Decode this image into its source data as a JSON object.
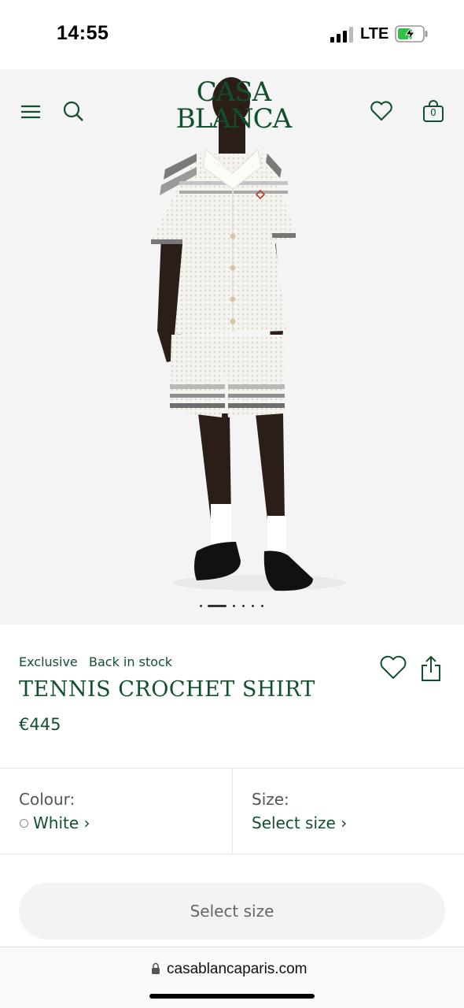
{
  "status_bar": {
    "time": "14:55",
    "network": "LTE",
    "icons": [
      "signal-bars-icon",
      "battery-charging-icon"
    ],
    "battery_color": "#30c048"
  },
  "header": {
    "logo_line1": "CASA",
    "logo_line2": "BLANCA",
    "cart_count": "0",
    "icons": [
      "menu-icon",
      "search-icon",
      "heart-icon",
      "bag-icon"
    ]
  },
  "gallery": {
    "image": "model-wearing-tennis-crochet-shirt-and-shorts",
    "active_slide": 1,
    "slide_count": 6
  },
  "product": {
    "badge_exclusive": "Exclusive",
    "badge_stock": "Back in stock",
    "name": "TENNIS CROCHET SHIRT",
    "price": "€445",
    "icons": [
      "heart-icon",
      "share-icon"
    ]
  },
  "options": {
    "colour_label": "Colour:",
    "colour_value": "White",
    "size_label": "Size:",
    "size_value": "Select size"
  },
  "cta": {
    "label": "Select size"
  },
  "browser": {
    "url": "casablancaparis.com"
  },
  "colors": {
    "brand_green": "#12502c",
    "hero_bg": "#f4f4f4"
  }
}
